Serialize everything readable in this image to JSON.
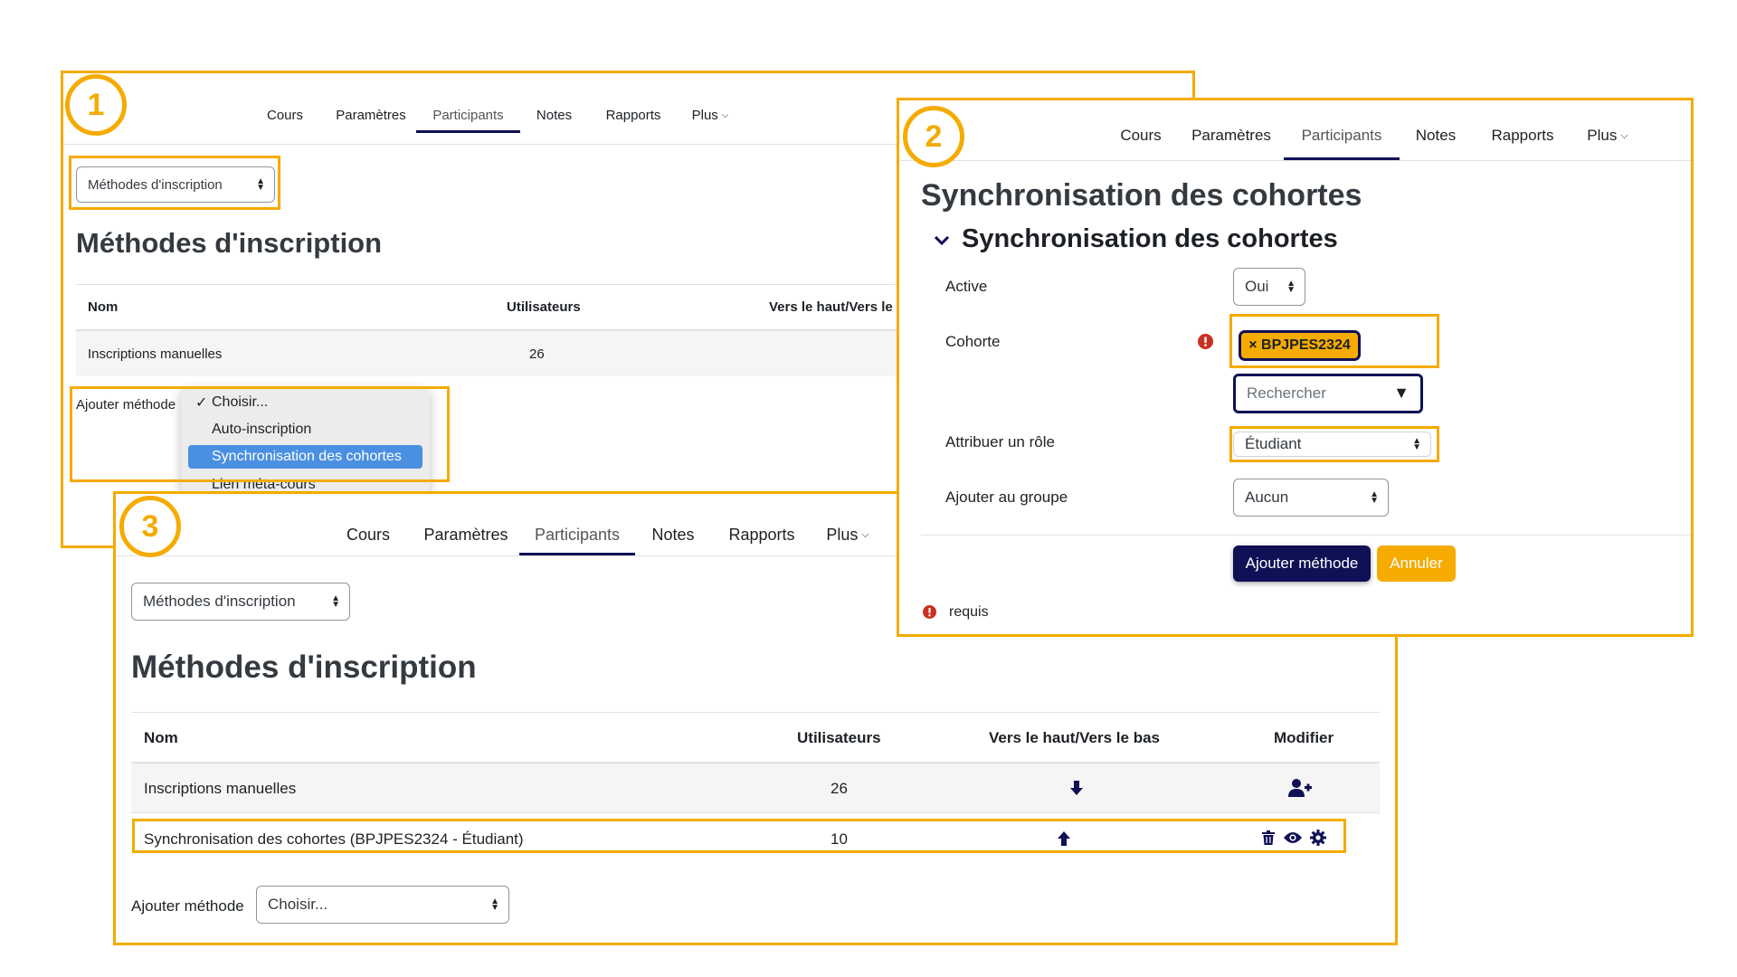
{
  "nav": {
    "items": [
      "Cours",
      "Paramètres",
      "Participants",
      "Notes",
      "Rapports",
      "Plus"
    ],
    "active": "Participants"
  },
  "badges": [
    "1",
    "2",
    "3"
  ],
  "panel1": {
    "selector": "Méthodes d'inscription",
    "heading": "Méthodes d'inscription",
    "columns": [
      "Nom",
      "Utilisateurs",
      "Vers le haut/Vers le b"
    ],
    "row": {
      "name": "Inscriptions manuelles",
      "users": "26"
    },
    "add_label": "Ajouter méthode",
    "dropdown": [
      "Choisir...",
      "Auto-inscription",
      "Synchronisation des cohortes",
      "Lien méta-cours"
    ],
    "checked": "✓"
  },
  "panel2": {
    "page_title": "Synchronisation des cohortes",
    "section_title": "Synchronisation des cohortes",
    "active_label": "Active",
    "active_value": "Oui",
    "cohort_label": "Cohorte",
    "cohort_tag": "× BPJPES2324",
    "search_placeholder": "Rechercher",
    "role_label": "Attribuer un rôle",
    "role_value": "Étudiant",
    "group_label": "Ajouter au groupe",
    "group_value": "Aucun",
    "submit": "Ajouter méthode",
    "cancel": "Annuler",
    "required": "requis"
  },
  "panel3": {
    "selector": "Méthodes d'inscription",
    "heading": "Méthodes d'inscription",
    "columns": [
      "Nom",
      "Utilisateurs",
      "Vers le haut/Vers le bas",
      "Modifier"
    ],
    "rows": [
      {
        "name": "Inscriptions manuelles",
        "users": "26"
      },
      {
        "name": "Synchronisation des cohortes (BPJPES2324 - Étudiant)",
        "users": "10"
      }
    ],
    "add_label": "Ajouter méthode",
    "add_value": "Choisir..."
  },
  "colors": {
    "highlight": "#f5ab00",
    "primary": "#0f1056",
    "required": "#ca3120"
  }
}
